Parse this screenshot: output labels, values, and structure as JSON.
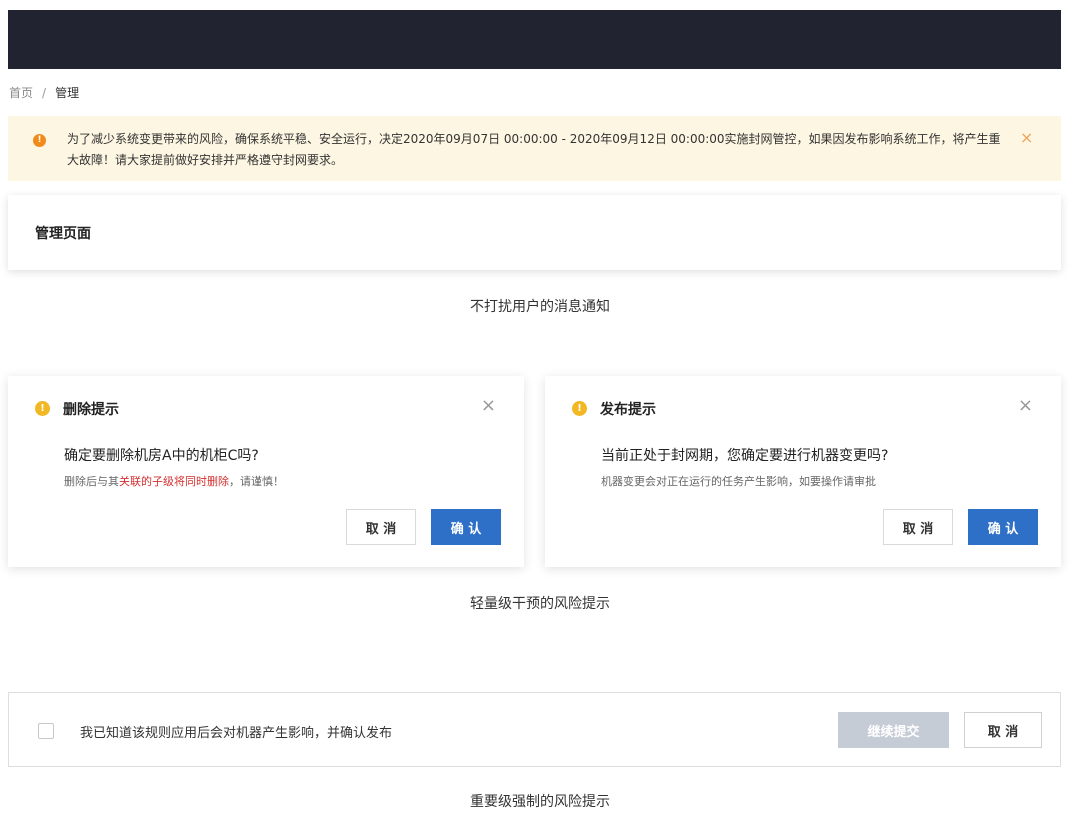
{
  "breadcrumb": {
    "home": "首页",
    "separator": "/",
    "current": "管理"
  },
  "banner": {
    "icon": "info-icon",
    "text": "为了减少系统变更带来的风险，确保系统平稳、安全运行，决定2020年09月07日 00:00:00 - 2020年09月12日 00:00:00实施封网管控，如果因发布影响系统工作，将产生重大故障！请大家提前做好安排并严格遵守封网要求。",
    "close": "×",
    "accent": "#ef8a1b",
    "background": "#fdf6e2"
  },
  "panel": {
    "title": "管理页面"
  },
  "captions": {
    "notify": "不打扰用户的消息通知",
    "light": "轻量级干预的风险提示",
    "strong": "重要级强制的风险提示"
  },
  "dialogs": [
    {
      "icon": "warning-icon",
      "title": "删除提示",
      "close": "×",
      "question": "确定要删除机房A中的机柜C吗?",
      "note_prefix": "删除后与其",
      "note_emphasis": "关联的子级将同时删除",
      "note_suffix": "，请谨慎！",
      "cancel": "取 消",
      "ok": "确 认"
    },
    {
      "icon": "warning-icon",
      "title": "发布提示",
      "close": "×",
      "question": "当前正处于封网期，您确定要进行机器变更吗?",
      "note": "机器变更会对正在运行的任务产生影响，如要操作请审批",
      "cancel": "取 消",
      "ok": "确 认"
    }
  ],
  "confirm": {
    "checkbox_label": "我已知道该规则应用后会对机器产生影响，并确认发布",
    "submit": "继续提交",
    "cancel": "取 消"
  },
  "colors": {
    "primary": "#2e6fc7",
    "danger": "#d43030",
    "warning": "#f2b824",
    "header": "#212430"
  }
}
